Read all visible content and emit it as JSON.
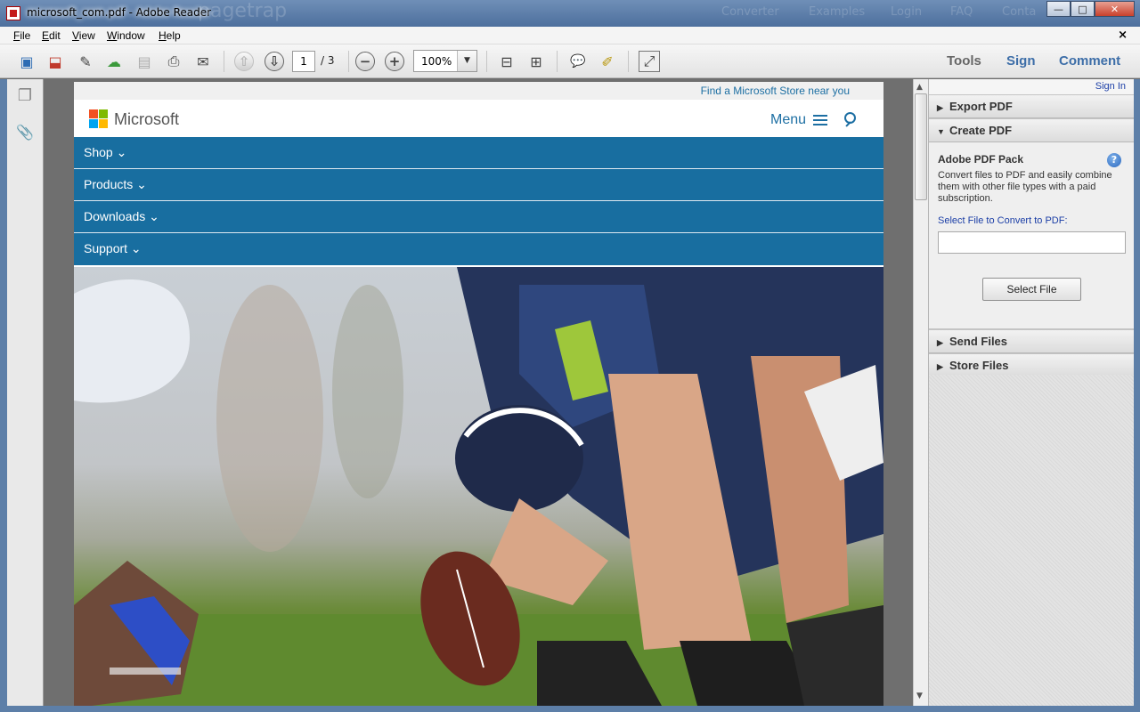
{
  "window": {
    "title": "microsoft_com.pdf - Adobe Reader",
    "ghost_text": [
      "pagetrap",
      "Converter",
      "Examples",
      "Login",
      "FAQ",
      "Conta"
    ],
    "minimize": "—",
    "maximize": "□",
    "close": "✕"
  },
  "menubar": {
    "items": [
      {
        "key": "F",
        "rest": "ile"
      },
      {
        "key": "E",
        "rest": "dit"
      },
      {
        "key": "V",
        "rest": "iew"
      },
      {
        "key": "W",
        "rest": "indow"
      },
      {
        "key": "H",
        "rest": "elp"
      }
    ],
    "close_doc": "×"
  },
  "toolbar": {
    "page_current": "1",
    "page_total": "/ 3",
    "zoom": "100%",
    "zoom_dropdown": "▼",
    "icons": [
      "create-pdf-icon",
      "export-pdf-icon",
      "edit-icon",
      "upload-cloud-icon",
      "save-icon",
      "print-icon",
      "email-icon",
      "prev-page-icon",
      "next-page-icon",
      "zoom-out-icon",
      "zoom-in-icon",
      "fit-page-icon",
      "fit-width-icon",
      "comment-icon",
      "highlight-icon",
      "fullscreen-icon"
    ],
    "glyphs": {
      "prev": "⇧",
      "next": "⇩",
      "zoom_out": "−",
      "zoom_in": "+",
      "create": "▣",
      "export": "⬓",
      "edit": "✎",
      "upload": "☁",
      "save": "▤",
      "print": "⎙",
      "email": "✉",
      "fitpage": "⊟",
      "fitwidth": "⊞",
      "comment": "💬",
      "highlight": "✐",
      "fullscreen": "⤢"
    },
    "tabs": {
      "tools": "Tools",
      "sign": "Sign",
      "comment": "Comment"
    }
  },
  "navpane": {
    "icons": [
      "pages-icon",
      "attachments-icon"
    ],
    "glyphs": {
      "pages": "❐",
      "attach": "📎"
    }
  },
  "page": {
    "find_store": "Find a Microsoft Store near you",
    "brand": "Microsoft",
    "menu_label": "Menu",
    "nav": [
      {
        "label": "Shop ⌄"
      },
      {
        "label": "Products ⌄"
      },
      {
        "label": "Downloads ⌄"
      },
      {
        "label": "Support ⌄"
      }
    ]
  },
  "scrollbar": {
    "up": "▲",
    "down": "▼"
  },
  "rightpane": {
    "sign_in": "Sign In",
    "sections": {
      "export": {
        "arrow": "▶",
        "label": "Export PDF"
      },
      "create": {
        "arrow": "▼",
        "label": "Create PDF"
      },
      "send": {
        "arrow": "▶",
        "label": "Send Files"
      },
      "store": {
        "arrow": "▶",
        "label": "Store Files"
      }
    },
    "pack_title": "Adobe PDF Pack",
    "help": "?",
    "pack_desc": "Convert files to PDF and easily combine them with other file types with a paid subscription.",
    "select_label": "Select File to Convert to PDF:",
    "select_value": "",
    "select_button": "Select File"
  },
  "colors": {
    "accent": "#186ea0",
    "link": "#1d6fa3",
    "panel_link": "#1b3ea6"
  }
}
